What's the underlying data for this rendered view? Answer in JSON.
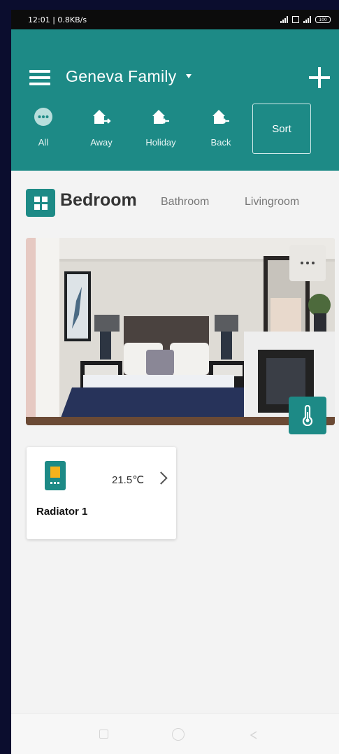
{
  "status_bar": {
    "time_speed": "12:01 | 0.8KB/s",
    "battery": "100"
  },
  "header": {
    "family_name": "Geneva Family",
    "modes": [
      {
        "label": "All",
        "icon": "dots-circle-icon"
      },
      {
        "label": "Away",
        "icon": "home-away-icon"
      },
      {
        "label": "Holiday",
        "icon": "home-holiday-icon"
      },
      {
        "label": "Back",
        "icon": "home-back-icon"
      }
    ],
    "sort_label": "Sort"
  },
  "rooms": {
    "active": "Bedroom",
    "others": [
      "Bathroom",
      "Livingroom"
    ]
  },
  "device": {
    "name": "Radiator 1",
    "temperature": "21.5℃"
  },
  "colors": {
    "accent": "#1d8a86",
    "display": "#f6b21c",
    "background": "#f3f3f3"
  }
}
